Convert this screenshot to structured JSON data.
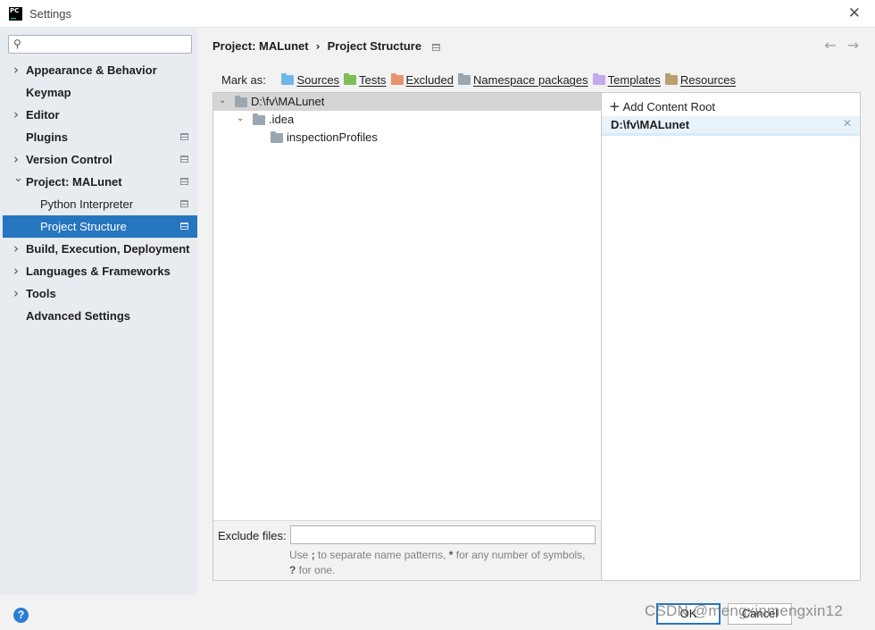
{
  "window": {
    "title": "Settings",
    "app_icon": "pycharm-logo",
    "close_icon": "close-icon"
  },
  "sidebar": {
    "search": {
      "value": "",
      "placeholder": ""
    },
    "items": [
      {
        "label": "Appearance & Behavior",
        "level": 0,
        "chevron": "right",
        "project_icon": false,
        "selected": false
      },
      {
        "label": "Keymap",
        "level": 0,
        "chevron": "none",
        "project_icon": false,
        "selected": false
      },
      {
        "label": "Editor",
        "level": 0,
        "chevron": "right",
        "project_icon": false,
        "selected": false
      },
      {
        "label": "Plugins",
        "level": 0,
        "chevron": "none",
        "project_icon": true,
        "selected": false
      },
      {
        "label": "Version Control",
        "level": 0,
        "chevron": "right",
        "project_icon": true,
        "selected": false
      },
      {
        "label": "Project: MALunet",
        "level": 0,
        "chevron": "down",
        "project_icon": true,
        "selected": false
      },
      {
        "label": "Python Interpreter",
        "level": 1,
        "chevron": "none",
        "project_icon": true,
        "selected": false
      },
      {
        "label": "Project Structure",
        "level": 1,
        "chevron": "none",
        "project_icon": true,
        "selected": true
      },
      {
        "label": "Build, Execution, Deployment",
        "level": 0,
        "chevron": "right",
        "project_icon": false,
        "selected": false
      },
      {
        "label": "Languages & Frameworks",
        "level": 0,
        "chevron": "right",
        "project_icon": false,
        "selected": false
      },
      {
        "label": "Tools",
        "level": 0,
        "chevron": "right",
        "project_icon": false,
        "selected": false
      },
      {
        "label": "Advanced Settings",
        "level": 0,
        "chevron": "none",
        "project_icon": false,
        "selected": false
      }
    ]
  },
  "header": {
    "breadcrumb": [
      "Project: MALunet",
      "Project Structure"
    ],
    "separator": "›",
    "back_icon": "arrow-left-icon",
    "forward_icon": "arrow-right-icon"
  },
  "mark_as": {
    "label": "Mark as:",
    "buttons": [
      {
        "label": "Sources",
        "color": "#6eb8e8"
      },
      {
        "label": "Tests",
        "color": "#7dbf57"
      },
      {
        "label": "Excluded",
        "color": "#e8936a"
      },
      {
        "label": "Namespace packages",
        "color": "#9aa7b0"
      },
      {
        "label": "Templates",
        "color": "#c3a9e8"
      },
      {
        "label": "Resources",
        "color": "#b9a06e"
      }
    ]
  },
  "tree": {
    "nodes": [
      {
        "label": "D:\\fv\\MALunet",
        "depth": 0,
        "expanded": true,
        "selected": true
      },
      {
        "label": ".idea",
        "depth": 1,
        "expanded": true,
        "selected": false
      },
      {
        "label": "inspectionProfiles",
        "depth": 2,
        "expanded": null,
        "selected": false
      }
    ]
  },
  "exclude": {
    "label": "Exclude files:",
    "value": "",
    "hint_parts": [
      "Use ",
      ";",
      " to separate name patterns, ",
      "*",
      " for any number of symbols, ",
      "?",
      " for one."
    ]
  },
  "content_roots": {
    "add_label": "Add Content Root",
    "roots": [
      {
        "label": "D:\\fv\\MALunet"
      }
    ]
  },
  "footer": {
    "help_label": "?",
    "ok_label": "OK",
    "cancel_label": "Cancel",
    "watermark": "CSDN @mengxinmengxin12"
  }
}
